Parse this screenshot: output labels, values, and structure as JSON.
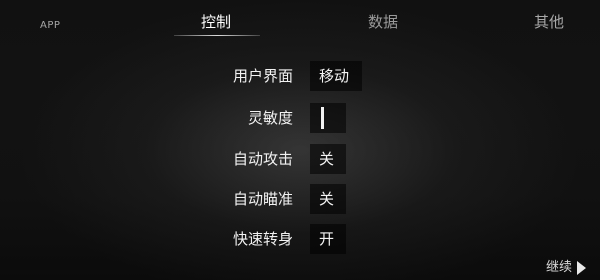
{
  "tabs": {
    "app": "APP",
    "control": "控制",
    "data": "数据",
    "other": "其他",
    "active": "控制"
  },
  "settings": [
    {
      "label": "用户界面",
      "value": "移动"
    },
    {
      "label": "灵敏度",
      "value": ""
    },
    {
      "label": "自动攻击",
      "value": "关"
    },
    {
      "label": "自动瞄准",
      "value": "关"
    },
    {
      "label": "快速转身",
      "value": "开"
    }
  ],
  "footer": {
    "continue_label": "继续",
    "continue_icon": "play-arrow-icon"
  }
}
